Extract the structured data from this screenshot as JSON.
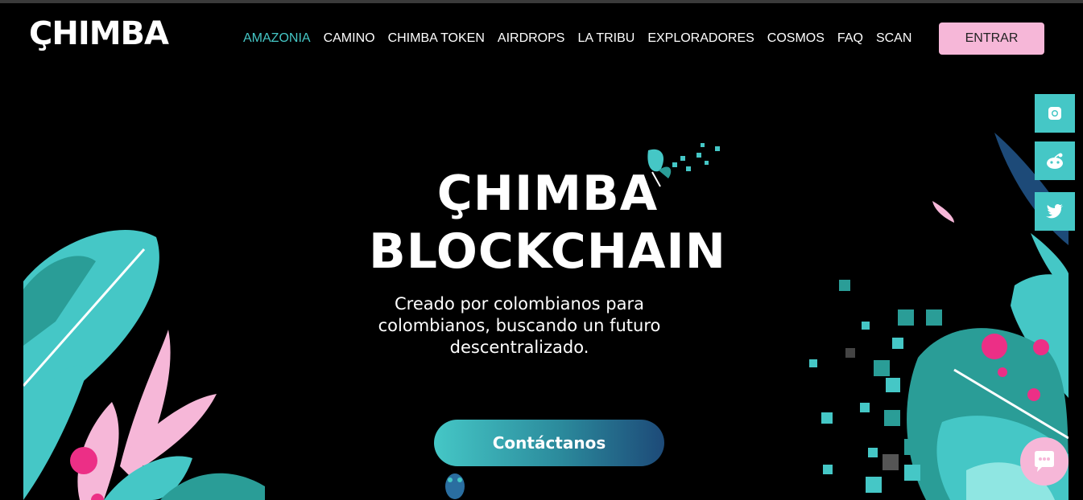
{
  "brand": {
    "logo_text": "ÇHIMBA"
  },
  "nav": {
    "items": [
      {
        "label": "AMAZONIA",
        "active": true
      },
      {
        "label": "CAMINO"
      },
      {
        "label": "CHIMBA TOKEN"
      },
      {
        "label": "AIRDROPS"
      },
      {
        "label": "LA TRIBU"
      },
      {
        "label": "EXPLORADORES"
      },
      {
        "label": "COSMOS"
      },
      {
        "label": "FAQ"
      },
      {
        "label": "SCAN"
      }
    ],
    "login_label": "ENTRAR"
  },
  "hero": {
    "title_line1": "ÇHIMBA",
    "title_line2": "BLOCKCHAIN",
    "subtitle": "Creado por colombianos para colombianos, buscando un futuro descentralizado.",
    "cta_label": "Contáctanos"
  },
  "social": {
    "icons": [
      "instagram-icon",
      "reddit-icon",
      "twitter-icon"
    ]
  },
  "colors": {
    "accent": "#45c7c6",
    "pink": "#f6b7d8",
    "magenta": "#ec2f86",
    "background": "#000000"
  }
}
